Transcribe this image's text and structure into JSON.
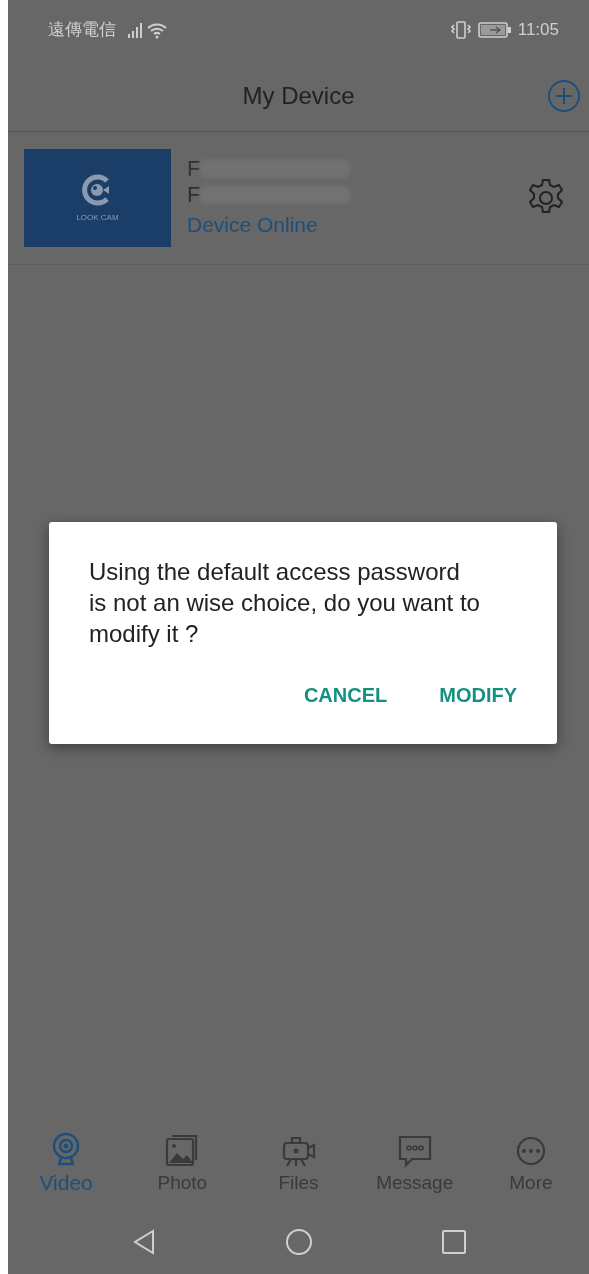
{
  "status_bar": {
    "carrier": "遠傳電信",
    "time": "11:05"
  },
  "header": {
    "title": "My Device"
  },
  "devices": [
    {
      "name": "F",
      "id": "F",
      "status": "Device Online",
      "logo_text": "LOOK CAM"
    }
  ],
  "tabs": [
    {
      "label": "Video",
      "selected": true
    },
    {
      "label": "Photo",
      "selected": false
    },
    {
      "label": "Files",
      "selected": false
    },
    {
      "label": "Message",
      "selected": false
    },
    {
      "label": "More",
      "selected": false
    }
  ],
  "dialog": {
    "message": "Using the default access password is not an wise choice, do you want to modify it ?",
    "buttons": [
      "CANCEL",
      "MODIFY"
    ]
  }
}
